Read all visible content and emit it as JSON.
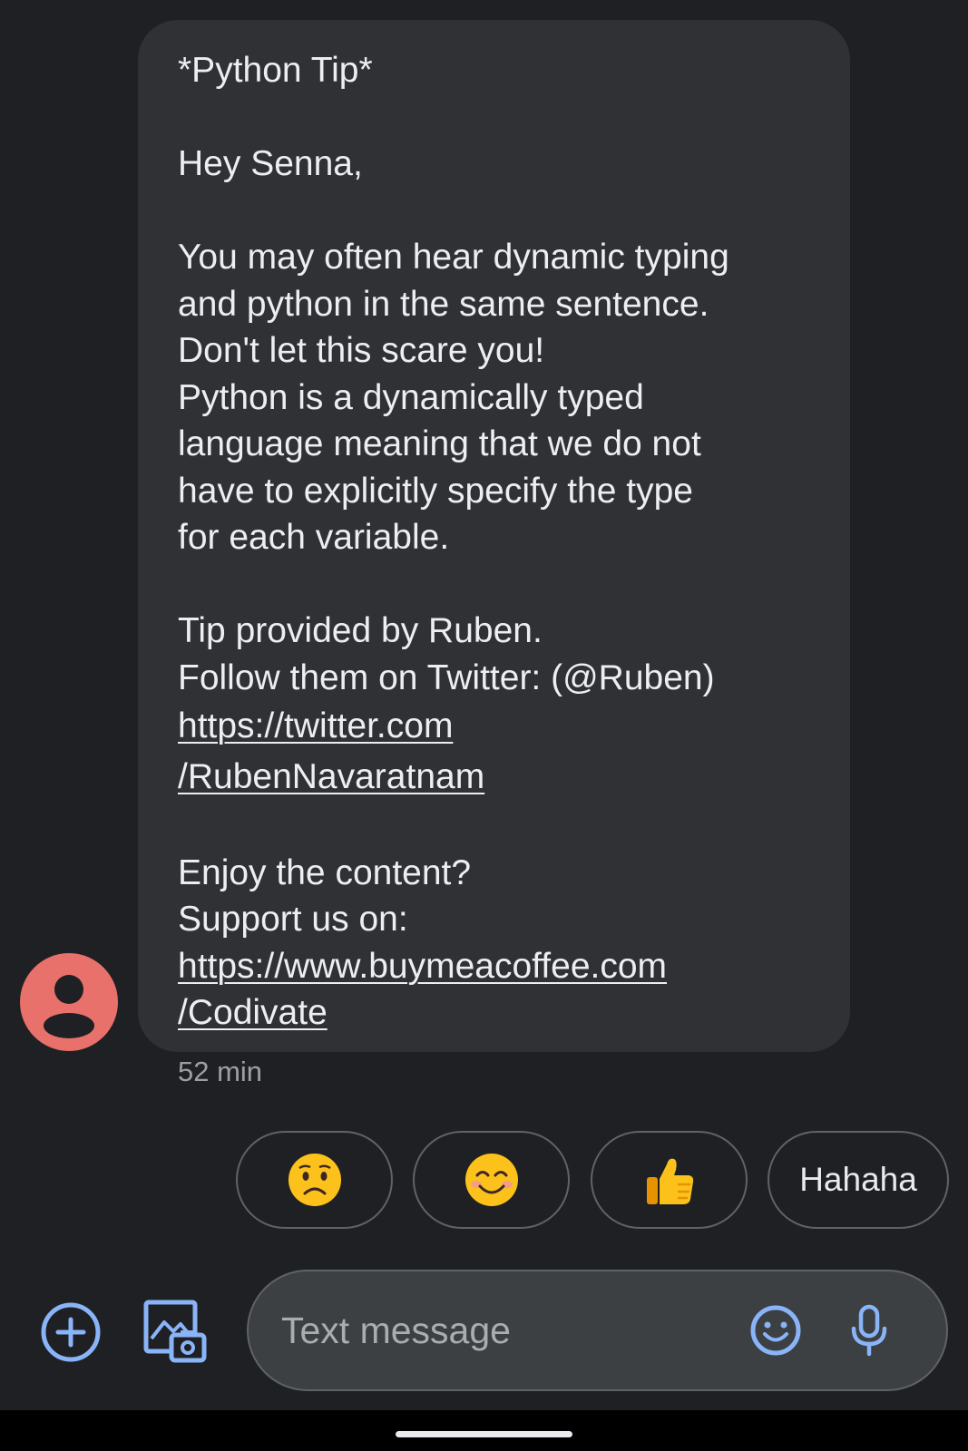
{
  "message": {
    "lines": [
      "*Python Tip*",
      "",
      "Hey Senna,",
      "",
      "You may often hear dynamic typing",
      "and python in the same sentence.",
      "Don't let this scare you!",
      "Python is a dynamically typed",
      "language meaning that we do not",
      "have to explicitly specify the type",
      "for each variable.",
      "",
      "Tip provided by Ruben.",
      "Follow them on Twitter: (@Ruben)"
    ],
    "twitter_link": [
      "https://twitter.com",
      "/RubenNavaratnam"
    ],
    "support_lines": [
      "Enjoy the content?",
      "Support us on:"
    ],
    "coffee_link": [
      "https://www.buymeacoffee.com",
      "/Codivate"
    ],
    "timestamp": "52 min"
  },
  "avatar": {
    "icon": "person-icon",
    "color": "#e8716b"
  },
  "smart_replies": [
    {
      "type": "emoji",
      "value": "😟",
      "icon": "worried-face-icon"
    },
    {
      "type": "emoji",
      "value": "😊",
      "icon": "smiling-face-icon"
    },
    {
      "type": "emoji",
      "value": "👍",
      "icon": "thumbs-up-icon"
    },
    {
      "type": "text",
      "value": "Hahaha"
    }
  ],
  "composer": {
    "placeholder": "Text message",
    "value": "",
    "icons": [
      "add-icon",
      "gallery-icon",
      "emoji-icon",
      "mic-icon"
    ],
    "accent_color": "#8ab4f8"
  }
}
